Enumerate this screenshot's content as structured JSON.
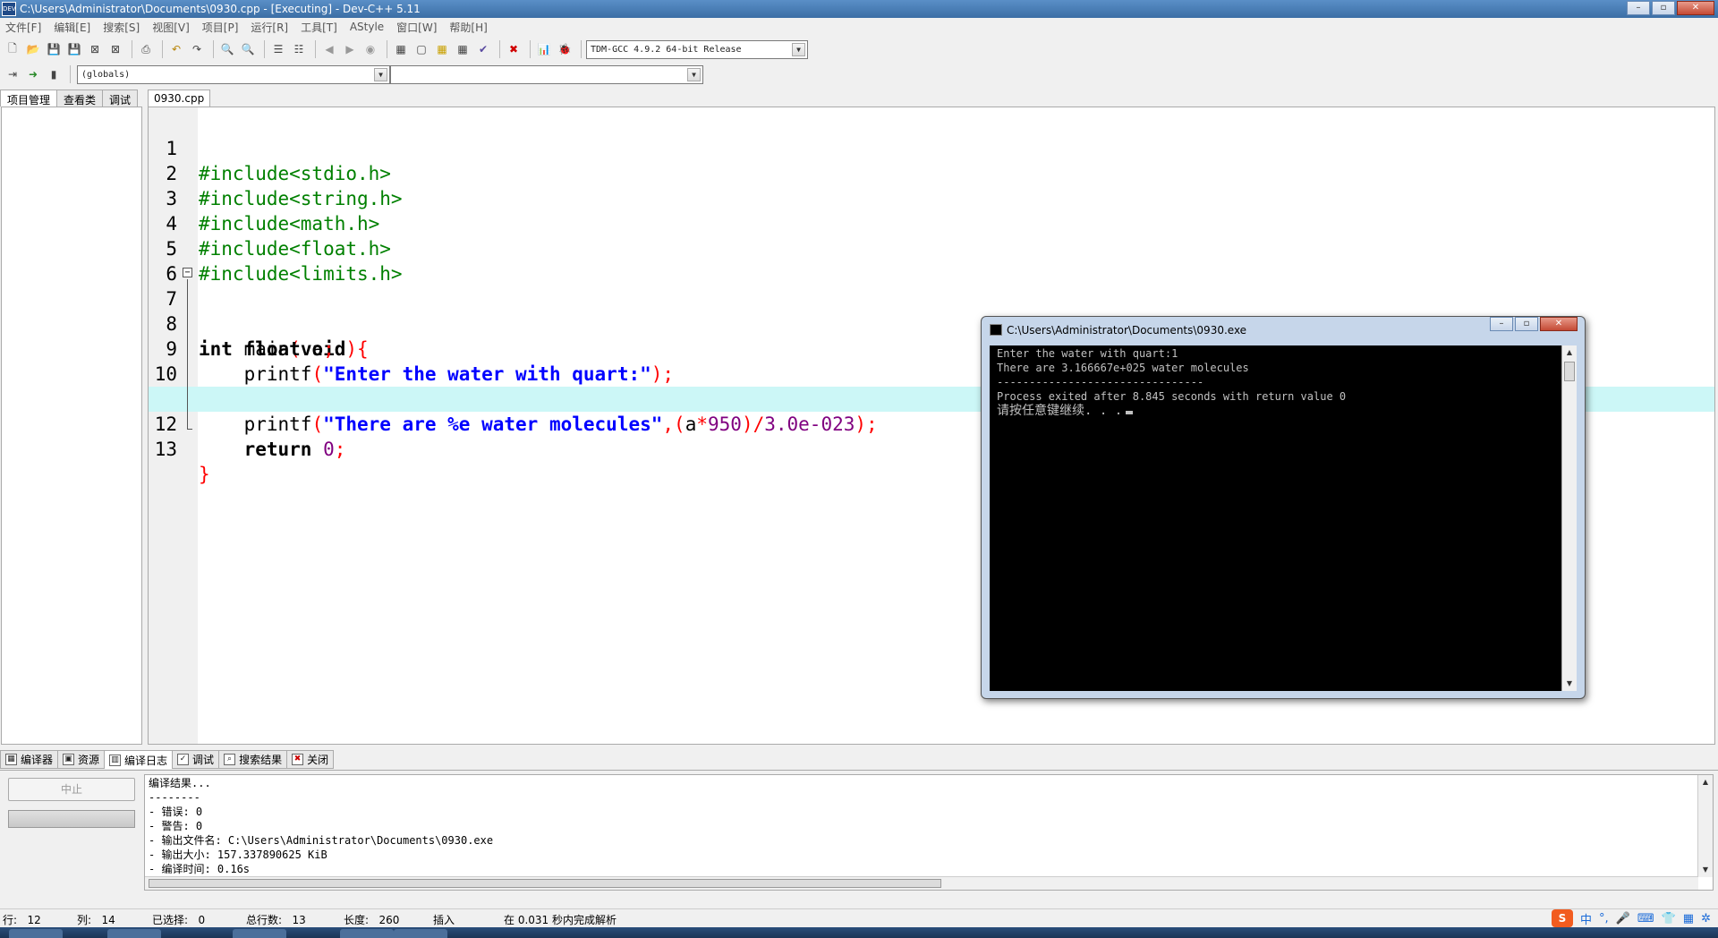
{
  "window": {
    "title": "C:\\Users\\Administrator\\Documents\\0930.cpp - [Executing] - Dev-C++ 5.11",
    "app_icon": "dev-cpp-icon",
    "title_color": "#3b6ea5"
  },
  "menu": [
    "文件[F]",
    "编辑[E]",
    "搜索[S]",
    "视图[V]",
    "项目[P]",
    "运行[R]",
    "工具[T]",
    "AStyle",
    "窗口[W]",
    "帮助[H]"
  ],
  "toolbar": {
    "compiler_select": "TDM-GCC 4.9.2 64-bit Release",
    "scope_select": "(globals)",
    "member_select": ""
  },
  "left_tabs": [
    "项目管理",
    "查看类",
    "调试"
  ],
  "editor": {
    "file_tab": "0930.cpp",
    "current_line": 12,
    "highlight_color": "#ccf7f7"
  },
  "console": {
    "title": "C:\\Users\\Administrator\\Documents\\0930.exe",
    "lines": [
      "Enter the water with quart:1",
      "There are 3.166667e+025 water molecules",
      "--------------------------------",
      "Process exited after 8.845 seconds with return value 0",
      "请按任意键继续. . ."
    ]
  },
  "bottom_tabs": [
    "编译器",
    "资源",
    "编译日志",
    "调试",
    "搜索结果",
    "关闭"
  ],
  "bottom": {
    "stop_label": "中止",
    "log": [
      "编译结果...",
      "--------",
      "- 错误: 0",
      "- 警告: 0",
      "- 输出文件名: C:\\Users\\Administrator\\Documents\\0930.exe",
      "- 输出大小: 157.337890625 KiB",
      "- 编译时间: 0.16s"
    ]
  },
  "status": {
    "row": "行:   12",
    "col": "列:   14",
    "selected": "已选择:   0",
    "total_lines": "总行数:   13",
    "length": "长度:   260",
    "mode": "插入",
    "parse": "在 0.031 秒内完成解析"
  },
  "ime": {
    "logo": "S",
    "lang": "中"
  }
}
